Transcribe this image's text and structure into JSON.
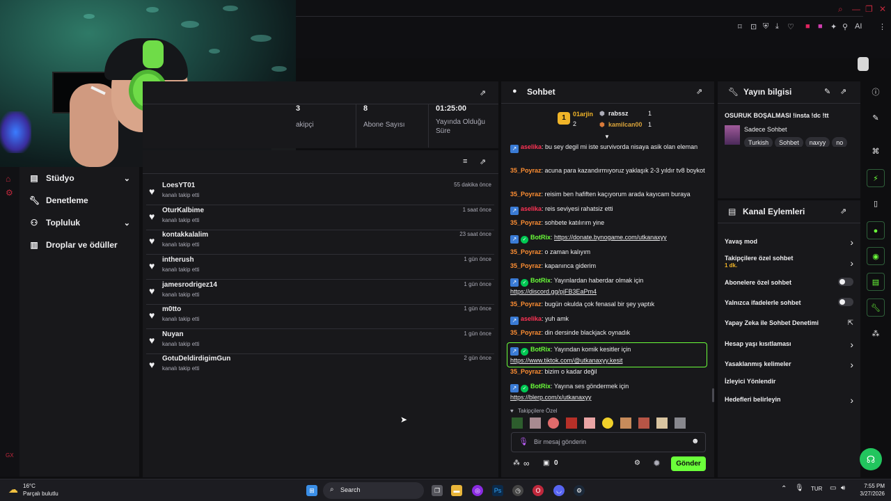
{
  "leftnav": {
    "items": [
      {
        "label": "Stüdyo",
        "icon": "layout-icon"
      },
      {
        "label": "Denetleme",
        "icon": "wrench-icon"
      },
      {
        "label": "Topluluk",
        "icon": "users-icon"
      },
      {
        "label": "Droplar ve ödüller",
        "icon": "gift-icon"
      }
    ],
    "rail_bottom": "GX"
  },
  "stats": {
    "items": [
      {
        "value": "3",
        "label": "akipçi"
      },
      {
        "value": "8",
        "label": "Abone Sayısı"
      },
      {
        "value": "01:25:00",
        "label": "Yayında Olduğu Süre"
      }
    ]
  },
  "activity": {
    "rows": [
      {
        "name": "LoesYT01",
        "sub": "kanalı takip etti",
        "time": "55 dakika önce"
      },
      {
        "name": "OturKalbime",
        "sub": "kanalı takip etti",
        "time": "1 saat önce"
      },
      {
        "name": "kontakkalalim",
        "sub": "kanalı takip etti",
        "time": "23 saat önce"
      },
      {
        "name": "intherush",
        "sub": "kanalı takip etti",
        "time": "1 gün önce"
      },
      {
        "name": "jamesrodrigez14",
        "sub": "kanalı takip etti",
        "time": "1 gün önce"
      },
      {
        "name": "m0tto",
        "sub": "kanalı takip etti",
        "time": "1 gün önce"
      },
      {
        "name": "Nuyan",
        "sub": "kanalı takip etti",
        "time": "1 gün önce"
      },
      {
        "name": "GotuDeldirdigimGun",
        "sub": "kanalı takip etti",
        "time": "2 gün önce"
      }
    ]
  },
  "chat": {
    "title": "Sohbet",
    "leaderboard": {
      "first": {
        "rank": "1",
        "name": "01arjin",
        "count": "2"
      },
      "second": {
        "name": "rabssz",
        "count": "1"
      },
      "third": {
        "name": "kamilcan00",
        "count": "1"
      }
    },
    "messages": [
      {
        "user": "aselika",
        "text": "bu sey degil mi iste survivorda nisaya asik olan eleman",
        "color": "#ff3355",
        "badge": true
      },
      {
        "user": "35_Poyraz",
        "text": "acuna para kazandırmıyoruz yaklaşık 2-3 yıldır tv8 boykot",
        "color": "#ff8f33"
      },
      {
        "user": "35_Poyraz",
        "text": "reisim ben hafiften kaçıyorum arada kayıcam buraya",
        "color": "#ff8f33"
      },
      {
        "user": "aselika",
        "text": "reis seviyesi rahatsiz etti",
        "color": "#ff3355",
        "badge": true
      },
      {
        "user": "35_Poyraz",
        "text": "sohbete katılırım yine",
        "color": "#ff8f33"
      },
      {
        "user": "BotRix",
        "text": "",
        "link": "https://donate.bynogame.com/utkanaxyy",
        "color": "#6bff3a",
        "badge": true,
        "verified": true
      },
      {
        "user": "35_Poyraz",
        "text": "o zaman kalıyım",
        "color": "#ff8f33"
      },
      {
        "user": "35_Poyraz",
        "text": "kapanınca giderim",
        "color": "#ff8f33"
      },
      {
        "user": "BotRix",
        "text": "Yayınlardan haberdar olmak için",
        "link": "https://discord.gg/pjFB3EaPm4",
        "color": "#6bff3a",
        "badge": true,
        "verified": true
      },
      {
        "user": "35_Poyraz",
        "text": "bugün okulda çok fenasal bir şey yaptık",
        "color": "#ff8f33"
      },
      {
        "user": "aselika",
        "text": "yuh amk",
        "color": "#ff3355",
        "badge": true
      },
      {
        "user": "35_Poyraz",
        "text": "din dersinde blackjack oynadık",
        "color": "#ff8f33"
      },
      {
        "user": "BotRix",
        "text": "Yayından komik kesitler için",
        "link": "https://www.tiktok.com/@utkanaxyy.kesit",
        "color": "#6bff3a",
        "badge": true,
        "verified": true,
        "highlight": true
      },
      {
        "user": "35_Poyraz",
        "text": "bizim o kadar değil",
        "color": "#ff8f33"
      },
      {
        "user": "BotRix",
        "text": "Yayına ses göndermek için",
        "link": "https://blerp.com/x/utkanaxyy",
        "color": "#6bff3a",
        "badge": true,
        "verified": true
      }
    ],
    "followers_only_label": "Takipçilere Özel",
    "input_placeholder": "Bir mesaj gönderin",
    "points": "∞",
    "store_count": "0",
    "send_label": "Gönder"
  },
  "streaminfo": {
    "title": "Yayın bilgisi",
    "stream_title": "OSURUK BOŞALMASI !insta !dc !tt",
    "category": "Sadece Sohbet",
    "tags": [
      "Turkish",
      "Sohbet",
      "naxyy",
      "no"
    ]
  },
  "channel_actions": {
    "title": "Kanal Eylemleri",
    "items": [
      {
        "label": "Yavaş mod",
        "control": "arrow"
      },
      {
        "label": "Takipçilere özel sohbet",
        "sub": "1 dk.",
        "control": "arrow"
      },
      {
        "label": "Abonelere özel sohbet",
        "control": "toggle"
      },
      {
        "label": "Yalnızca ifadelerle sohbet",
        "control": "toggle"
      },
      {
        "label": "Yapay Zeka ile Sohbet Denetimi",
        "control": "external"
      },
      {
        "label": "Hesap yaşı kısıtlaması",
        "control": "arrow"
      },
      {
        "label": "Yasaklanmış kelimeler",
        "control": "arrow"
      },
      {
        "label": "İzleyici Yönlendir",
        "control": "none"
      },
      {
        "label": "Hedefleri belirleyin",
        "control": "arrow"
      }
    ]
  },
  "taskbar": {
    "weather_temp": "16°C",
    "weather_desc": "Parçalı bulutlu",
    "search_label": "Search",
    "lang": "TUR",
    "time": "7:55 PM",
    "date": "3/27/2026"
  },
  "browser": {
    "ai_label": "AI"
  }
}
